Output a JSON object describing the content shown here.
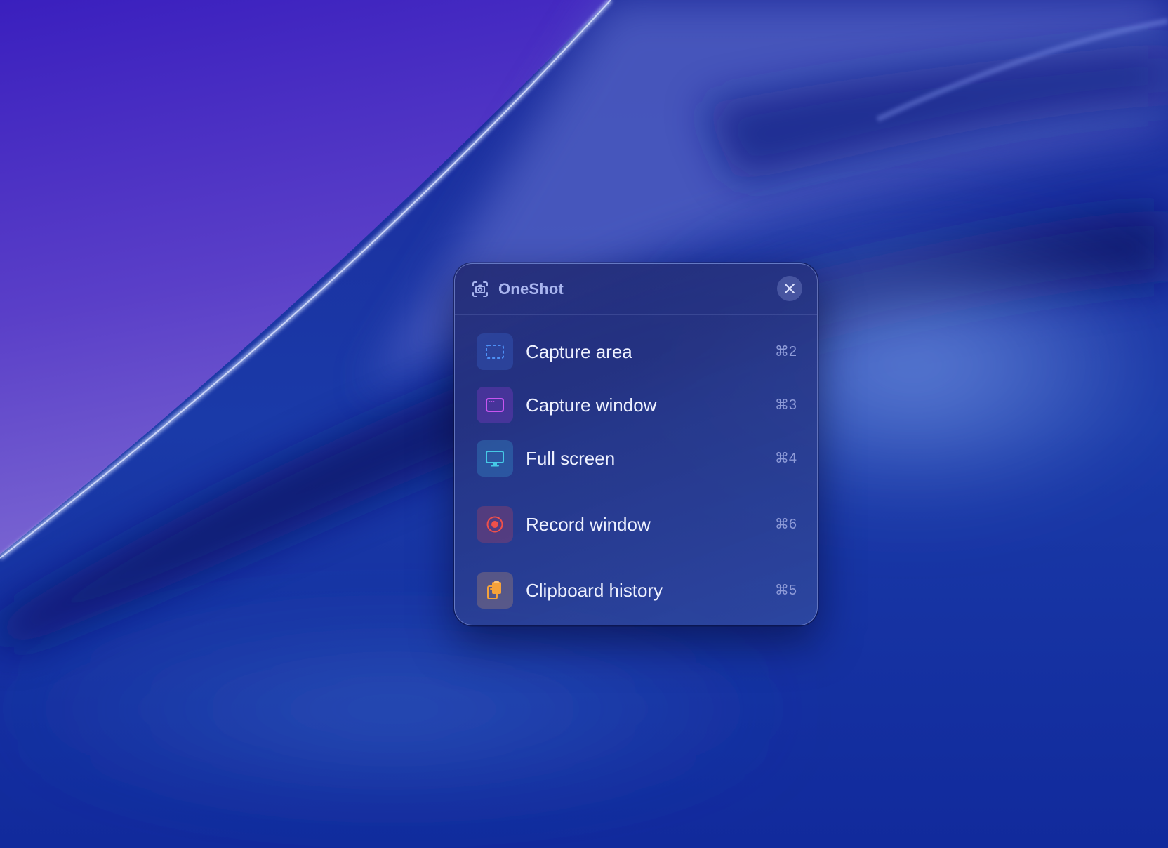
{
  "app": {
    "title": "OneShot"
  },
  "menu": {
    "items": [
      {
        "label": "Capture area",
        "shortcut": "⌘2",
        "icon": "dashed-selection-icon",
        "accent": "#4d8ff5"
      },
      {
        "label": "Capture window",
        "shortcut": "⌘3",
        "icon": "window-icon",
        "accent": "#c855f0"
      },
      {
        "label": "Full screen",
        "shortcut": "⌘4",
        "icon": "monitor-icon",
        "accent": "#45c9e6"
      },
      {
        "label": "Record window",
        "shortcut": "⌘6",
        "icon": "record-icon",
        "accent": "#f0504a"
      },
      {
        "label": "Clipboard history",
        "shortcut": "⌘5",
        "icon": "clipboard-icon",
        "accent": "#f5a23a"
      }
    ]
  },
  "colors": {
    "title": "#a9b5ef",
    "label": "#eef1ff",
    "shortcut": "#8e9bd8"
  }
}
